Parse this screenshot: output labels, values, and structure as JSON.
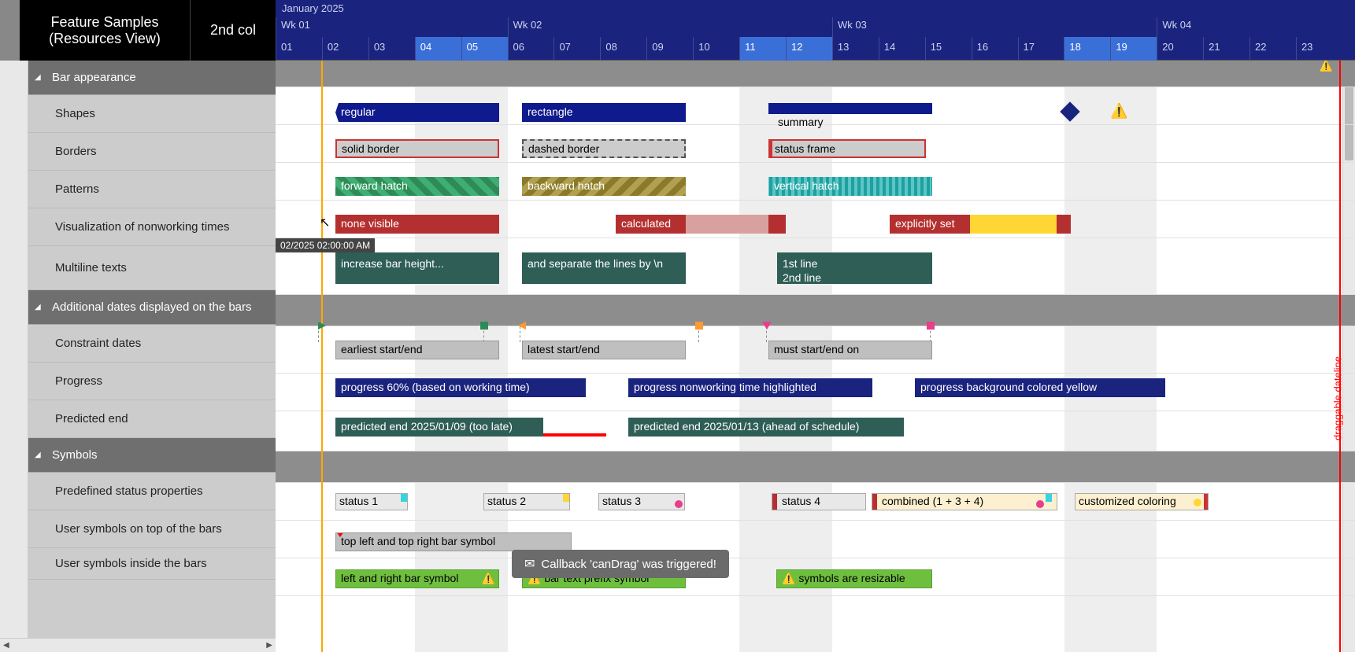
{
  "header": {
    "title_line1": "Feature Samples",
    "title_line2": "(Resources View)",
    "col2": "2nd col"
  },
  "tree": {
    "groups": [
      {
        "label": "Bar appearance",
        "items": [
          "Shapes",
          "Borders",
          "Patterns",
          "Visualization of nonworking times",
          "Multiline texts"
        ]
      },
      {
        "label": "Additional dates displayed on the bars",
        "items": [
          "Constraint dates",
          "Progress",
          "Predicted end"
        ]
      },
      {
        "label": "Symbols",
        "items": [
          "Predefined status properties",
          "User symbols on top of the bars",
          "User symbols inside the bars"
        ]
      }
    ]
  },
  "timeline": {
    "month": "January 2025",
    "weeks": [
      "Wk 01",
      "Wk 02",
      "Wk 03",
      "Wk 04"
    ],
    "days": [
      "01",
      "02",
      "03",
      "04",
      "05",
      "06",
      "07",
      "08",
      "09",
      "10",
      "11",
      "12",
      "13",
      "14",
      "15",
      "16",
      "17",
      "18",
      "19",
      "20",
      "21",
      "22",
      "23"
    ],
    "highlighted_days": [
      "04",
      "05",
      "11",
      "12",
      "18",
      "19"
    ],
    "draggable_label": "draggable dateline",
    "tooltip": "02/2025 02:00:00 AM"
  },
  "bars": {
    "shapes": {
      "regular": "regular",
      "rectangle": "rectangle",
      "summary": "summary"
    },
    "borders": {
      "solid": "solid border",
      "dashed": "dashed border",
      "status": "status frame"
    },
    "patterns": {
      "fwd": "forward hatch",
      "bwd": "backward hatch",
      "vert": "vertical hatch"
    },
    "nonworking": {
      "none": "none visible",
      "calc": "calculated",
      "expl": "explicitly set"
    },
    "multiline": {
      "a": "increase bar height...",
      "b": "and separate the lines by \\n",
      "c": "1st line\n2nd line"
    },
    "constraint": {
      "a": "earliest start/end",
      "b": "latest start/end",
      "c": "must start/end on"
    },
    "progress": {
      "a": "progress 60% (based on working time)",
      "b": "progress nonworking time highlighted",
      "c": "progress background colored yellow"
    },
    "predicted": {
      "a": "predicted end 2025/01/09 (too late)",
      "b": "predicted end 2025/01/13 (ahead of schedule)"
    },
    "status": {
      "s1": "status 1",
      "s2": "status 2",
      "s3": "status 3",
      "s4": "status 4",
      "combined": "combined (1 + 3 + 4)",
      "custom": "customized coloring"
    },
    "usersym_top": "top left and top right bar symbol",
    "usersym_in": {
      "a": "left and right bar symbol",
      "b": "bar text prefix symbol",
      "c": "symbols are resizable"
    }
  },
  "toast": "Callback 'canDrag' was triggered!"
}
